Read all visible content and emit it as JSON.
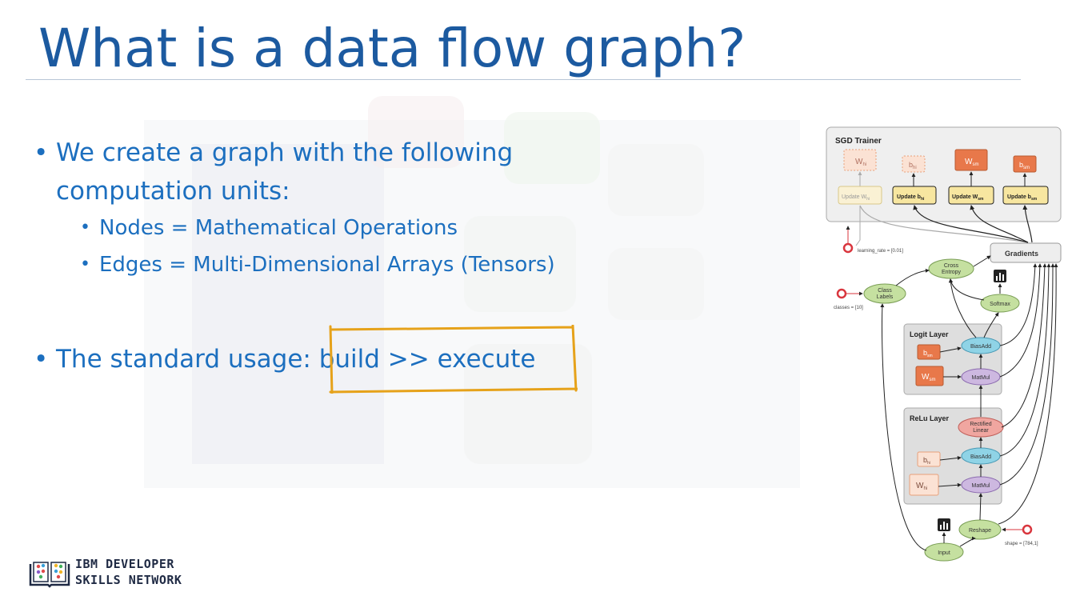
{
  "slide": {
    "title": "What is a data flow graph?"
  },
  "bullets": {
    "main": "We create a graph with the following computation units:",
    "sub1": "Nodes = Mathematical Operations",
    "sub2": "Edges = Multi-Dimensional Arrays (Tensors)",
    "usage": "The standard usage: build >> execute",
    "dot": "•"
  },
  "logo": {
    "line1": "IBM DEVELOPER",
    "line2": "SKILLS NETWORK"
  },
  "diagram": {
    "sgd_title": "SGD Trainer",
    "params": [
      "W",
      "b",
      "W",
      "b"
    ],
    "param_subs": [
      "hi",
      "hi",
      "sm",
      "sm"
    ],
    "updates": [
      "Update W",
      "Update b",
      "Update W",
      "Update b"
    ],
    "update_subs": [
      "hi",
      "hi",
      "sm",
      "sm"
    ],
    "gradients": "Gradients",
    "learning_rate": "learning_rate = [0.01]",
    "cross_entropy_l1": "Cross",
    "cross_entropy_l2": "Entropy",
    "class_labels_l1": "Class",
    "class_labels_l2": "Labels",
    "classes": "classes = [10]",
    "softmax": "Softmax",
    "logit_layer": "Logit Layer",
    "logit_bias": "BiasAdd",
    "logit_matmul": "MatMul",
    "logit_b": "b",
    "logit_b_sub": "sm",
    "logit_w": "W",
    "logit_w_sub": "sm",
    "relu_layer": "ReLu Layer",
    "relu_l1": "Rectified",
    "relu_l2": "Linear",
    "relu_bias": "BiasAdd",
    "relu_matmul": "MatMul",
    "relu_b": "b",
    "relu_b_sub": "hi",
    "relu_w": "W",
    "relu_w_sub": "hi",
    "reshape": "Reshape",
    "shape": "shape = [784,1]",
    "input": "Input"
  },
  "colors": {
    "title": "#1c5aa0",
    "bullet_text": "#1c6fbf",
    "highlight_box": "#e6a21a",
    "op_green": "#c5e0a0",
    "op_blue": "#8fd3e6",
    "op_purple": "#cdb8e0",
    "op_red": "#f0a6a0",
    "param_orange": "#e8784a",
    "update_yellow": "#f7e6a0"
  }
}
